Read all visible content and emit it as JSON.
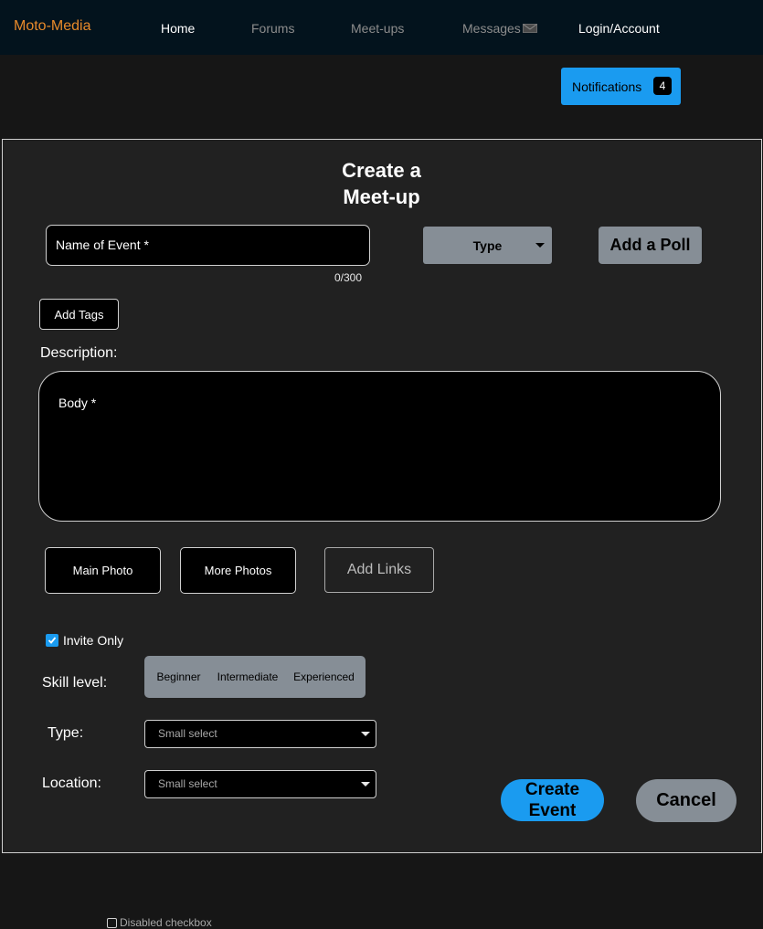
{
  "navbar": {
    "brand": "Moto-Media",
    "links": [
      {
        "label": "Home",
        "active": true
      },
      {
        "label": "Forums",
        "active": false
      },
      {
        "label": "Meet-ups",
        "active": false
      },
      {
        "label": "Messages",
        "active": false
      },
      {
        "label": "Login/Account",
        "active": true
      }
    ],
    "messages_icon": "envelope-icon"
  },
  "notifications": {
    "label": "Notifications",
    "count": "4"
  },
  "form": {
    "title_line1": "Create a",
    "title_line2": "Meet-up",
    "name_placeholder": "Name of Event *",
    "char_count": "0/300",
    "type_dropdown": "Type",
    "add_poll": "Add a Poll",
    "add_tags": "Add Tags",
    "description_label": "Description:",
    "body_placeholder": "Body *",
    "main_photo": "Main Photo",
    "more_photos": "More Photos",
    "add_links": "Add Links",
    "invite_only_label": "Invite Only",
    "invite_only_checked": true,
    "skill_label": "Skill level:",
    "skill_options": [
      "Beginner",
      "Intermediate",
      "Experienced"
    ],
    "type_label": "Type:",
    "type_select": "Small select",
    "location_label": "Location:",
    "location_select": "Small select",
    "create_line1": "Create",
    "create_line2": "Event",
    "cancel": "Cancel"
  },
  "footer": {
    "disabled_checkbox_label": "Disabled checkbox"
  },
  "colors": {
    "accent": "#1a9bf0",
    "brand": "#e88a2a",
    "secondary": "#868e96",
    "navbar_bg": "#03131d",
    "panel_bg": "#212121"
  }
}
